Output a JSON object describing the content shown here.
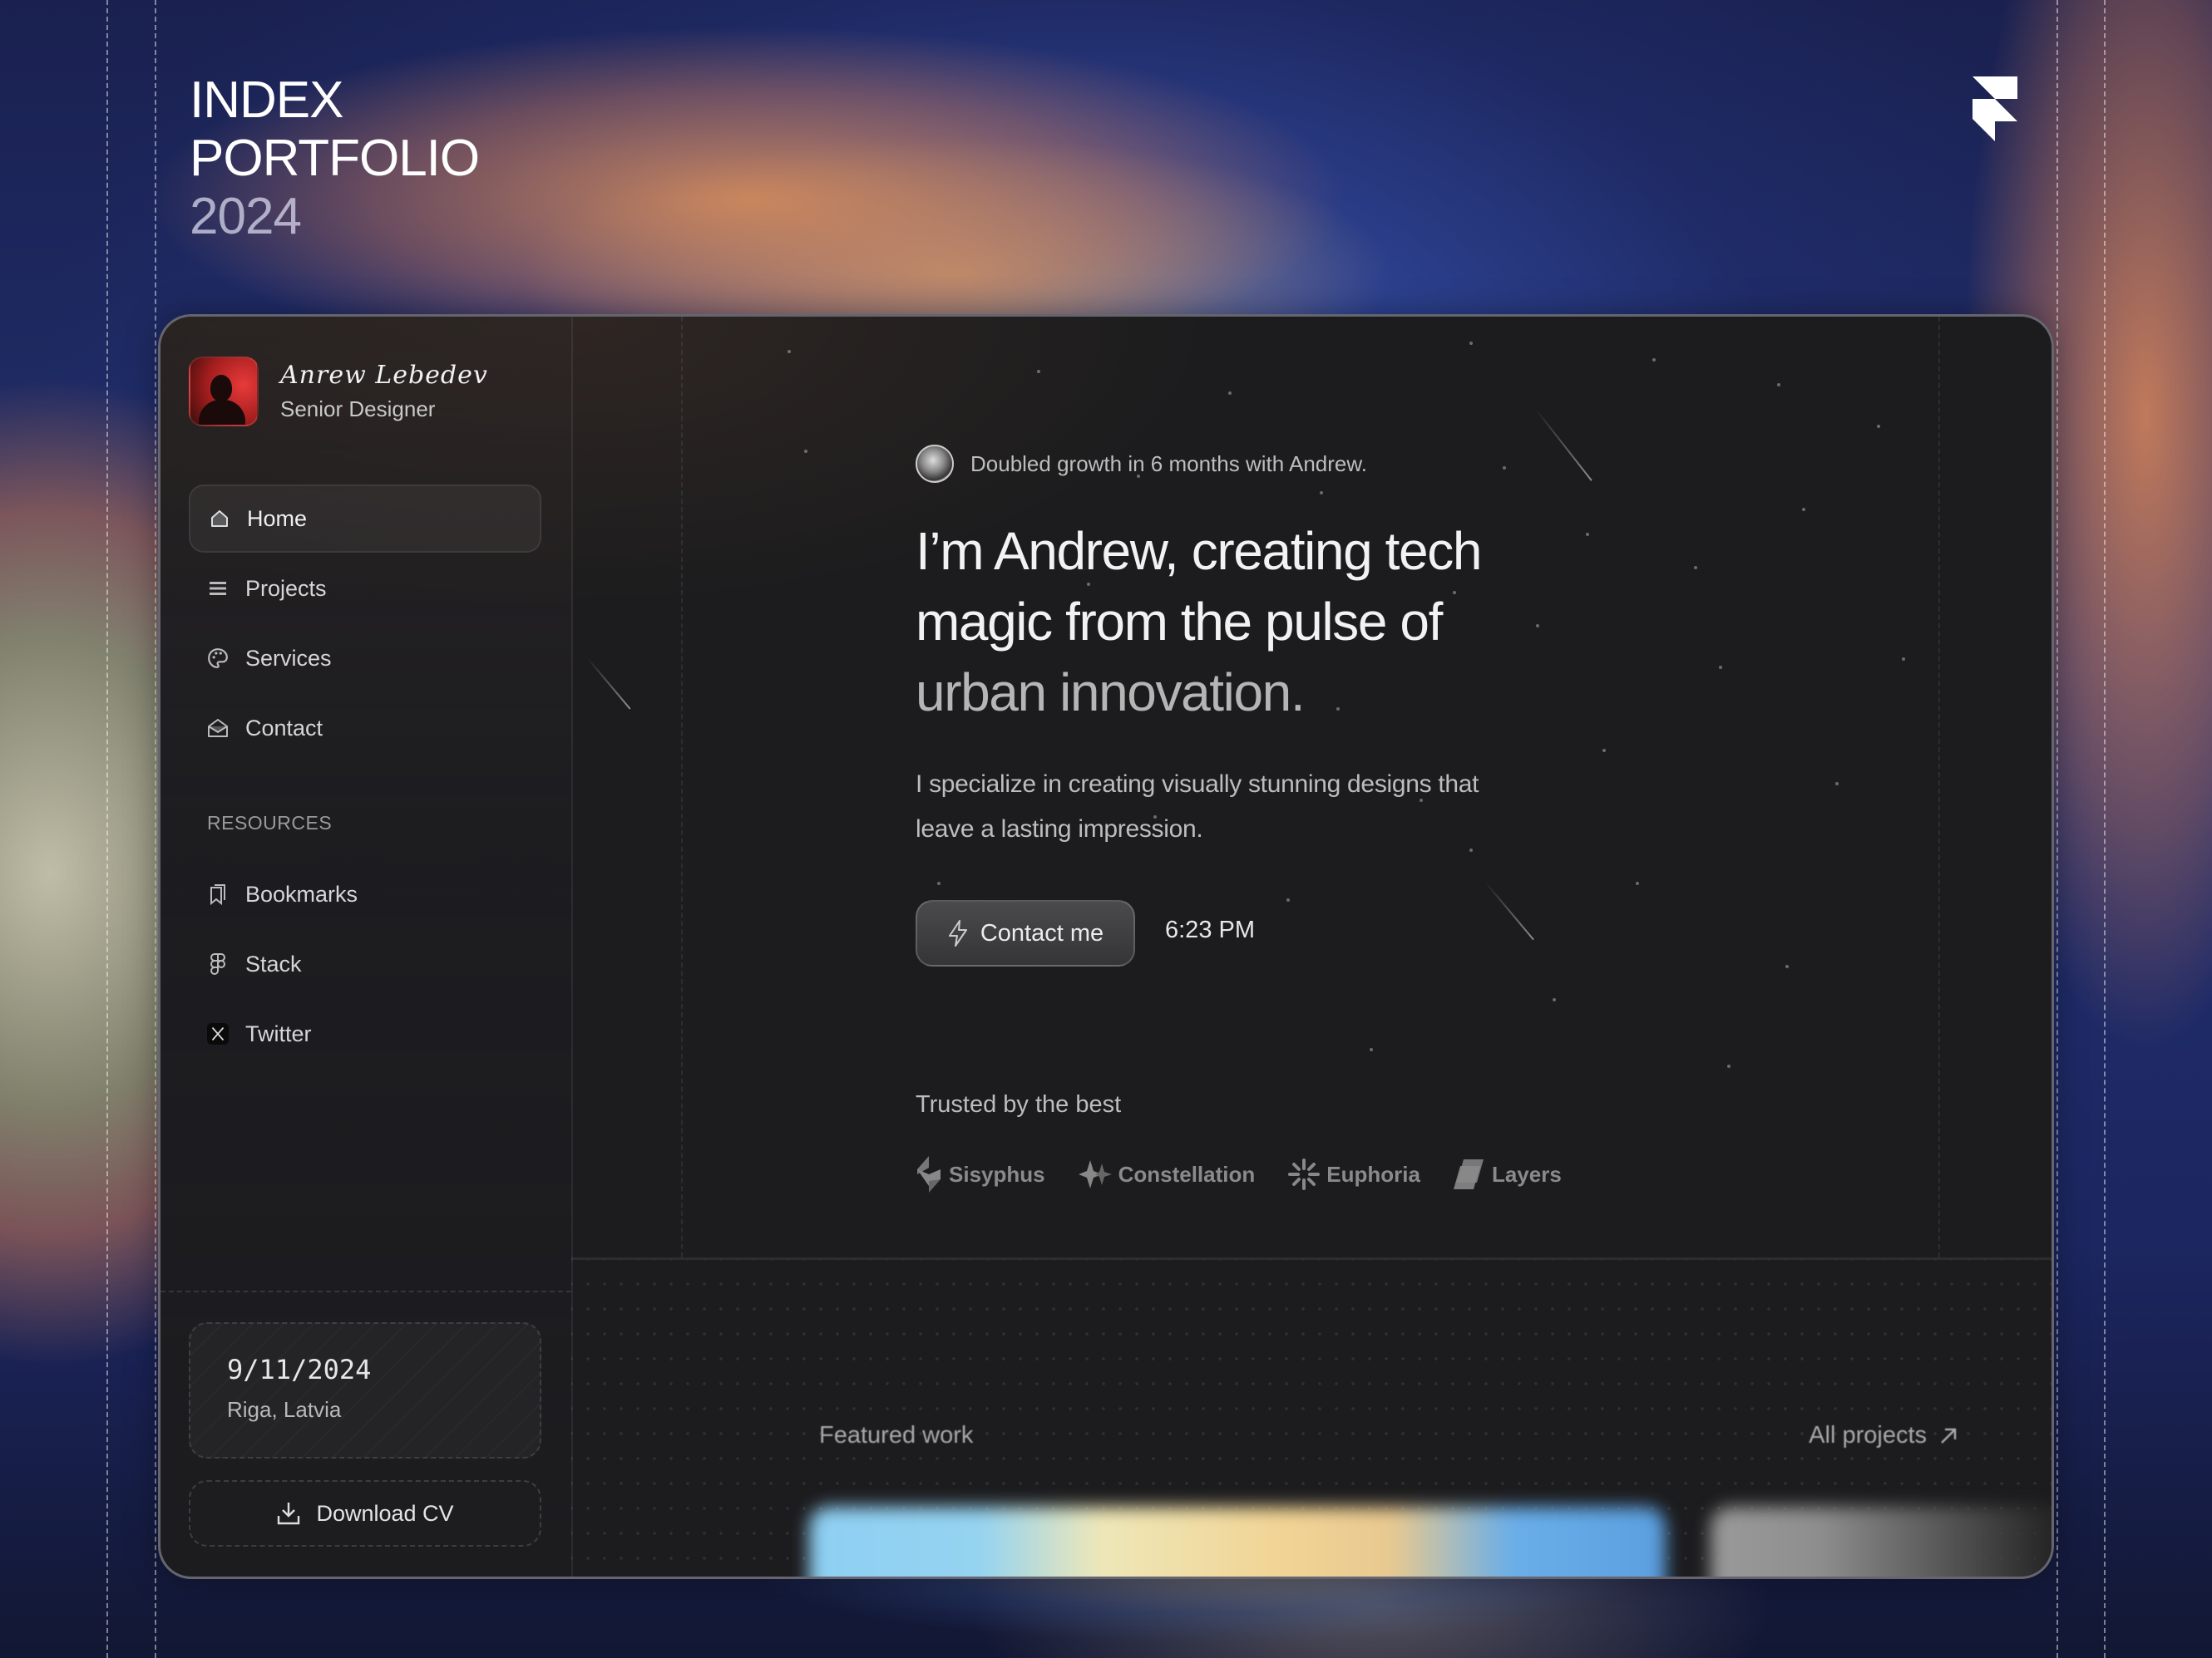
{
  "title": {
    "line1": "INDEX",
    "line2": "PORTFOLIO",
    "line3": "2024"
  },
  "brand_logo": "framer-logo",
  "profile": {
    "name": "Anrew Lebedev",
    "role": "Senior Designer"
  },
  "nav": {
    "items": [
      {
        "label": "Home",
        "icon": "home-icon",
        "active": true
      },
      {
        "label": "Projects",
        "icon": "list-icon",
        "active": false
      },
      {
        "label": "Services",
        "icon": "palette-icon",
        "active": false
      },
      {
        "label": "Contact",
        "icon": "mail-open-icon",
        "active": false
      }
    ],
    "resources_label": "RESOURCES",
    "resources": [
      {
        "label": "Bookmarks",
        "icon": "bookmarks-icon"
      },
      {
        "label": "Stack",
        "icon": "figma-icon"
      },
      {
        "label": "Twitter",
        "icon": "x-icon"
      }
    ]
  },
  "info_card": {
    "date": "9/11/2024",
    "location": "Riga, Latvia"
  },
  "download_cv": "Download CV",
  "hero": {
    "badge": "Doubled growth in 6 months with Andrew.",
    "headline_1": "I’m Andrew, creating tech",
    "headline_2": "magic from the pulse of",
    "headline_3": "urban innovation.",
    "subtext": "I specialize in creating visually stunning designs that leave a lasting impression.",
    "contact_button": "Contact me",
    "time": "6:23 PM",
    "trusted_label": "Trusted by the best",
    "logos": [
      {
        "name": "Sisyphus",
        "icon": "sisyphus-logo-icon"
      },
      {
        "name": "Constellation",
        "icon": "constellation-logo-icon"
      },
      {
        "name": "Euphoria",
        "icon": "euphoria-logo-icon"
      },
      {
        "name": "Layers",
        "icon": "layers-logo-icon"
      }
    ]
  },
  "featured": {
    "title": "Featured work",
    "all_projects": "All projects"
  },
  "colors": {
    "panel": "#1c1c1e",
    "accent_text": "#f2f2f2",
    "muted_text": "#bdbdbd",
    "avatar_red": "#e83a3a"
  }
}
